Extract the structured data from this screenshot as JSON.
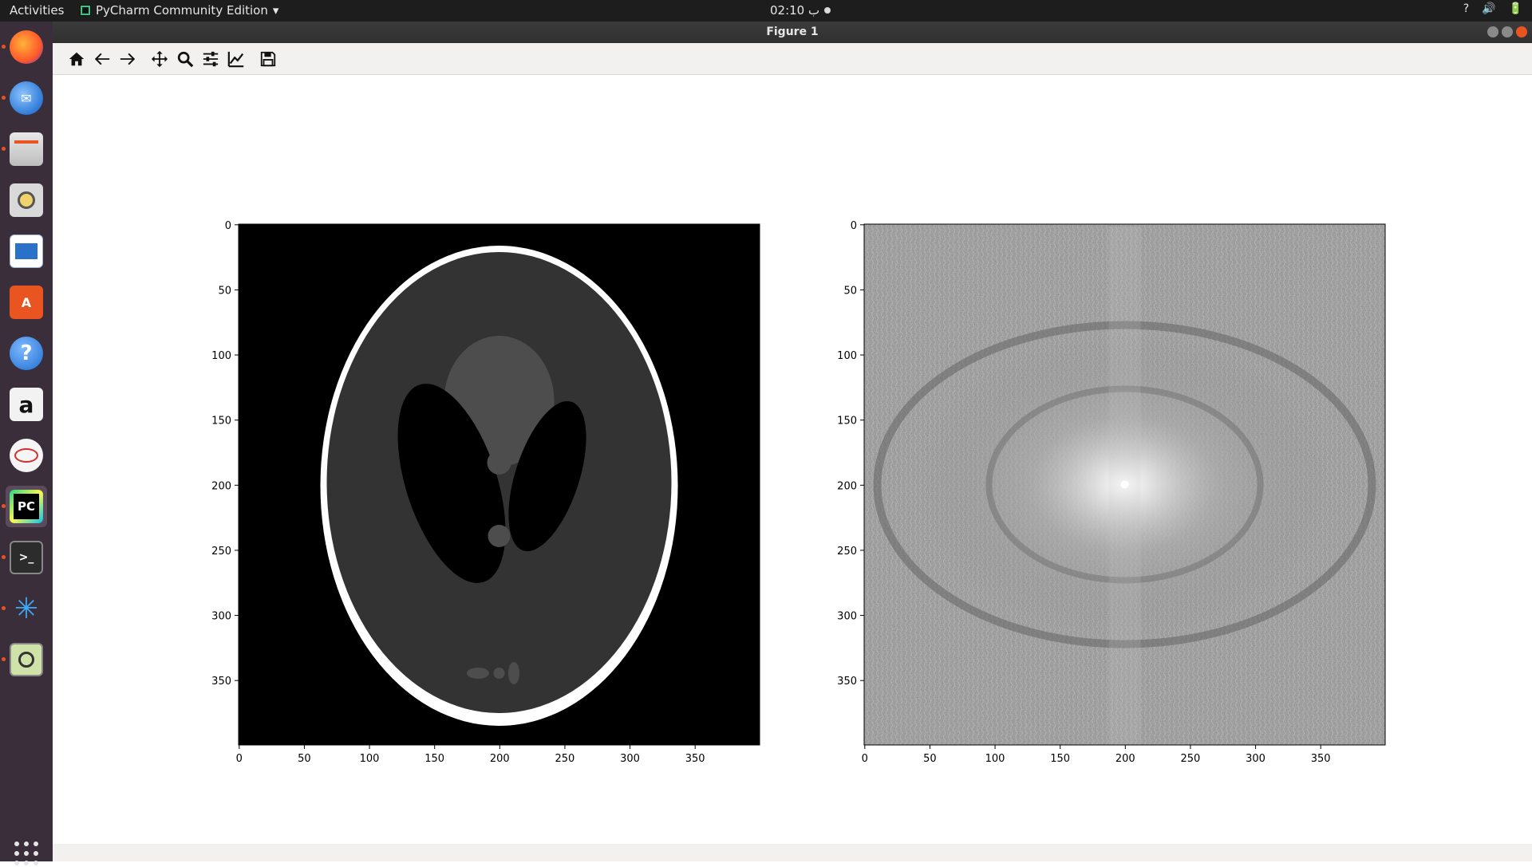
{
  "topbar": {
    "activities": "Activities",
    "app_menu": "PyCharm Community Edition",
    "clock": "02:10 ب",
    "tray": [
      "?",
      "🔊",
      "🔋"
    ]
  },
  "launcher": {
    "items": [
      {
        "name": "firefox-icon",
        "color": "#ff7139"
      },
      {
        "name": "thunderbird-icon",
        "color": "#2f7bd7"
      },
      {
        "name": "files-icon",
        "color": "#d4d4d4"
      },
      {
        "name": "rhythmbox-icon",
        "color": "#f0d36b"
      },
      {
        "name": "libreoffice-writer-icon",
        "color": "#2a72c9"
      },
      {
        "name": "software-center-icon",
        "color": "#e95420"
      },
      {
        "name": "help-icon",
        "color": "#3f8ee3"
      },
      {
        "name": "amazon-icon",
        "color": "#f2f2f2"
      },
      {
        "name": "remmina-icon",
        "color": "#f5f5f5"
      },
      {
        "name": "pycharm-icon",
        "color": "#21d789"
      },
      {
        "name": "terminal-icon",
        "color": "#2c2c2c"
      },
      {
        "name": "spyder-icon",
        "color": "#3da9f5"
      },
      {
        "name": "image-viewer-icon",
        "color": "#8fb860"
      }
    ]
  },
  "window": {
    "title": "Figure 1",
    "toolbar": {
      "buttons": [
        "home-icon",
        "back-icon",
        "forward-icon",
        "pan-icon",
        "zoom-icon",
        "subplots-icon",
        "customize-icon",
        "save-icon"
      ]
    }
  },
  "chart_data": [
    {
      "type": "heatmap",
      "title": "",
      "xlabel": "",
      "ylabel": "",
      "xlim": [
        0,
        400
      ],
      "ylim": [
        400,
        0
      ],
      "xticks": [
        0,
        50,
        100,
        150,
        200,
        250,
        300,
        350
      ],
      "yticks": [
        0,
        50,
        100,
        150,
        200,
        250,
        300,
        350
      ],
      "colormap": "gray",
      "content": "Shepp-Logan phantom"
    },
    {
      "type": "heatmap",
      "title": "",
      "xlabel": "",
      "ylabel": "",
      "xlim": [
        0,
        400
      ],
      "ylim": [
        400,
        0
      ],
      "xticks": [
        0,
        50,
        100,
        150,
        200,
        250,
        300,
        350
      ],
      "yticks": [
        0,
        50,
        100,
        150,
        200,
        250,
        300,
        350
      ],
      "colormap": "gray",
      "content": "log-magnitude Fourier spectrum"
    }
  ]
}
